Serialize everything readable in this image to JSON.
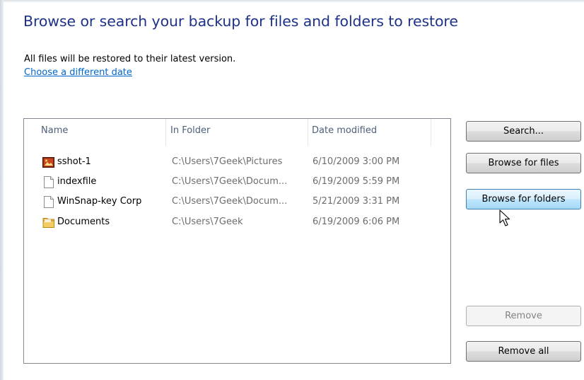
{
  "header": {
    "title": "Browse or search your backup for files and folders to restore",
    "info": "All files will be restored to their latest version.",
    "link": "Choose a different date"
  },
  "list": {
    "columns": [
      "Name",
      "In Folder",
      "Date modified"
    ],
    "rows": [
      {
        "name": "sshot-1",
        "folder": "C:\\Users\\7Geek\\Pictures",
        "date": "6/10/2009 3:00 PM",
        "icon": "image-file-icon"
      },
      {
        "name": "indexfile",
        "folder": "C:\\Users\\7Geek\\Docum...",
        "date": "6/19/2009 5:59 PM",
        "icon": "document-file-icon"
      },
      {
        "name": "WinSnap-key Corp",
        "folder": "C:\\Users\\7Geek\\Docum...",
        "date": "5/21/2009 3:31 PM",
        "icon": "document-file-icon"
      },
      {
        "name": "Documents",
        "folder": "C:\\Users\\7Geek",
        "date": "6/19/2009 6:06 PM",
        "icon": "folder-icon"
      }
    ]
  },
  "buttons": {
    "search": "Search...",
    "browse_files": "Browse for files",
    "browse_folders": "Browse for folders",
    "remove": "Remove",
    "remove_all": "Remove all"
  },
  "colors": {
    "title": "#1e3287",
    "link": "#0066cc",
    "header_text": "#4c607a",
    "hover_border": "#3c7fb1"
  }
}
